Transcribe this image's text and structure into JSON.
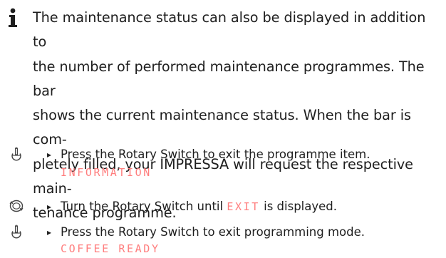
{
  "info": {
    "icon": "info-icon",
    "lines": [
      "The maintenance status can also be displayed in addition to",
      "the number of performed maintenance programmes. The bar",
      "shows the current maintenance status. When the bar is com-",
      "pletely filled, your IMPRESSA will request the respective main-",
      "tenance programme."
    ]
  },
  "steps": [
    {
      "icon": "press-rotary-switch-icon",
      "arrow": "▸",
      "text": "Press the Rotary Switch to exit the programme item.",
      "display": "INFORMATION"
    },
    {
      "icon": "turn-rotary-switch-icon",
      "arrow": "▸",
      "text_before": "Turn the Rotary Switch until ",
      "display_inline": "EXIT",
      "text_after": " is displayed."
    },
    {
      "icon": "press-rotary-switch-icon",
      "arrow": "▸",
      "text": "Press the Rotary Switch to exit programming mode.",
      "display": "COFFEE READY"
    }
  ],
  "colors": {
    "display": "#ff7e7e",
    "text": "#1e1e1e"
  }
}
